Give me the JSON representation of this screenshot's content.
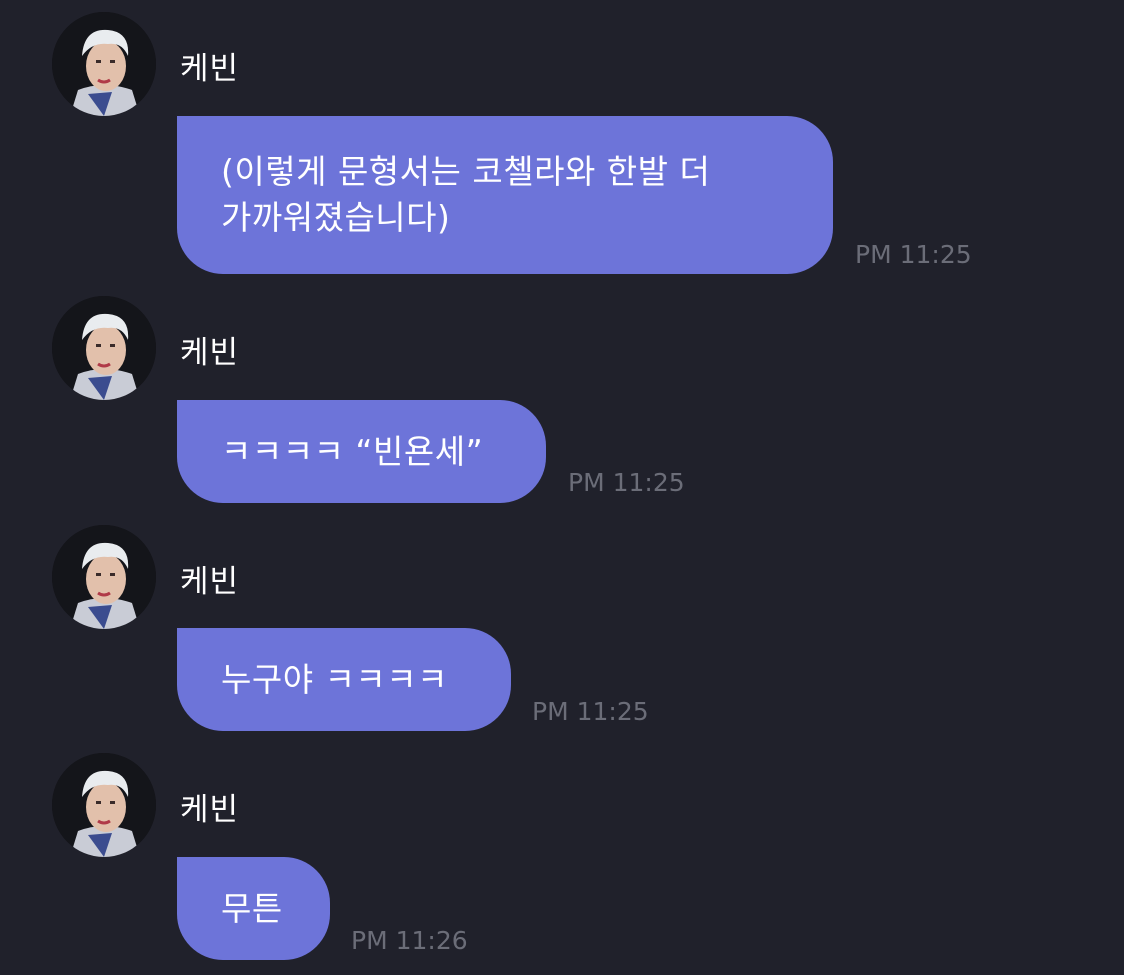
{
  "messages": [
    {
      "sender": "케빈",
      "text": "(이렇게 문형서는 코첼라와 한발 더\n가까워졌습니다)",
      "time": "PM 11:25"
    },
    {
      "sender": "케빈",
      "text": "ㅋㅋㅋㅋ “빈욘세”",
      "time": "PM 11:25"
    },
    {
      "sender": "케빈",
      "text": "누구야 ㅋㅋㅋㅋ",
      "time": "PM 11:25"
    },
    {
      "sender": "케빈",
      "text": "무튼",
      "time": "PM 11:26"
    }
  ],
  "colors": {
    "background": "#20212b",
    "bubble": "#6d74d9",
    "time": "#6b6d78",
    "sender": "#ffffff"
  },
  "icons": {
    "avatar": "profile-photo"
  }
}
